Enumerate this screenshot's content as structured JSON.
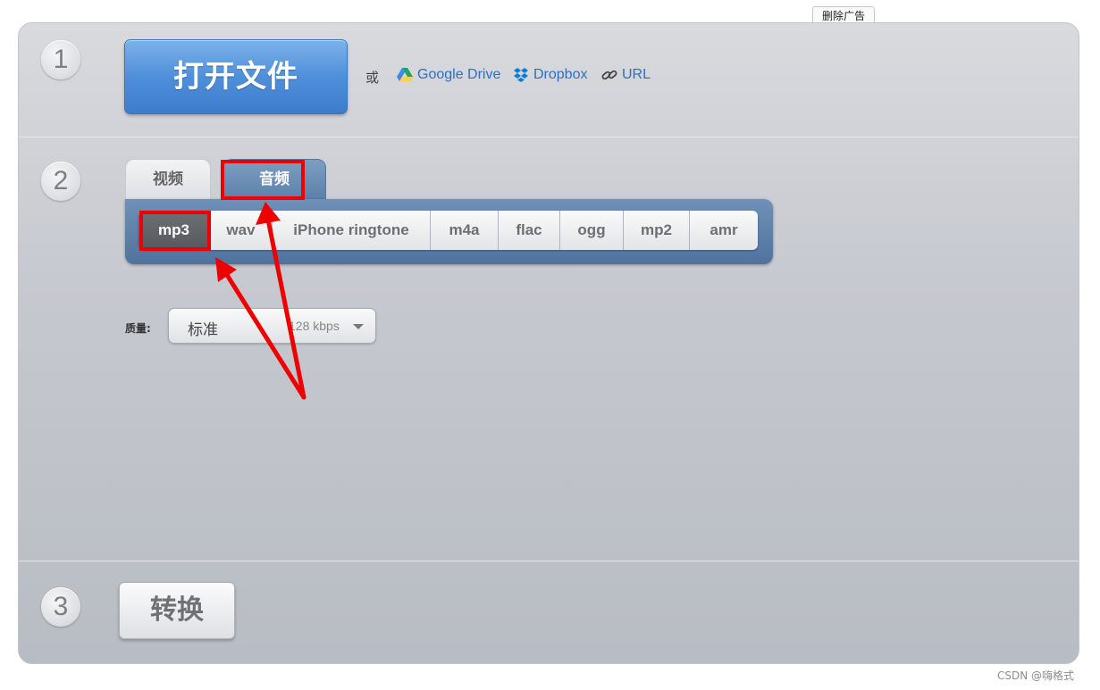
{
  "ad": {
    "remove_label": "删除广告"
  },
  "step1": {
    "number": "1",
    "open_button_label": "打开文件",
    "or_text": "或",
    "sources": [
      {
        "label": "Google Drive",
        "icon": "google-drive-icon"
      },
      {
        "label": "Dropbox",
        "icon": "dropbox-icon"
      },
      {
        "label": "URL",
        "icon": "link-icon"
      }
    ]
  },
  "step2": {
    "number": "2",
    "tabs": [
      {
        "label": "视频",
        "active": false
      },
      {
        "label": "音频",
        "active": true
      }
    ],
    "formats": [
      {
        "label": "mp3",
        "active": true
      },
      {
        "label": "wav",
        "active": false
      },
      {
        "label": "iPhone ringtone",
        "active": false
      },
      {
        "label": "m4a",
        "active": false
      },
      {
        "label": "flac",
        "active": false
      },
      {
        "label": "ogg",
        "active": false
      },
      {
        "label": "mp2",
        "active": false
      },
      {
        "label": "amr",
        "active": false
      }
    ],
    "quality": {
      "label": "质量:",
      "value": "标准",
      "rate": "128 kbps"
    }
  },
  "step3": {
    "number": "3",
    "convert_label": "转换"
  },
  "watermark": "CSDN @嗨格式",
  "colors": {
    "accent_blue": "#4f8fda",
    "link_blue": "#2a6fc7",
    "annotation_red": "#ee0000",
    "format_bar": "#5b80aa"
  }
}
